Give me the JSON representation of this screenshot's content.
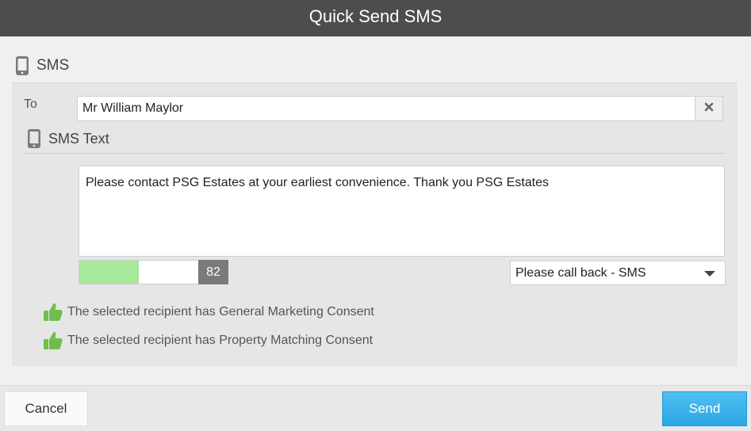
{
  "window": {
    "title": "Quick Send SMS"
  },
  "sms_section": {
    "heading": "SMS",
    "icon": "mobile-phone-icon"
  },
  "to": {
    "label": "To",
    "value": "Mr William Maylor",
    "clear_icon": "close-icon"
  },
  "sms_text": {
    "heading": "SMS Text",
    "icon": "mobile-phone-icon",
    "message": "Please contact PSG Estates at your earliest convenience. Thank you PSG Estates",
    "char_count": "82",
    "char_fill_fraction": 0.5,
    "char_fill_color": "#a8e89a"
  },
  "template": {
    "selected": "Please call back - SMS"
  },
  "consents": [
    {
      "icon": "thumbs-up-icon",
      "text": "The selected recipient has General Marketing Consent"
    },
    {
      "icon": "thumbs-up-icon",
      "text": "The selected recipient has Property Matching Consent"
    }
  ],
  "colors": {
    "accent": "#2aa6e6",
    "consent_icon": "#6cc04a",
    "titlebar": "#4d4d4d"
  },
  "footer": {
    "cancel_label": "Cancel",
    "send_label": "Send"
  }
}
